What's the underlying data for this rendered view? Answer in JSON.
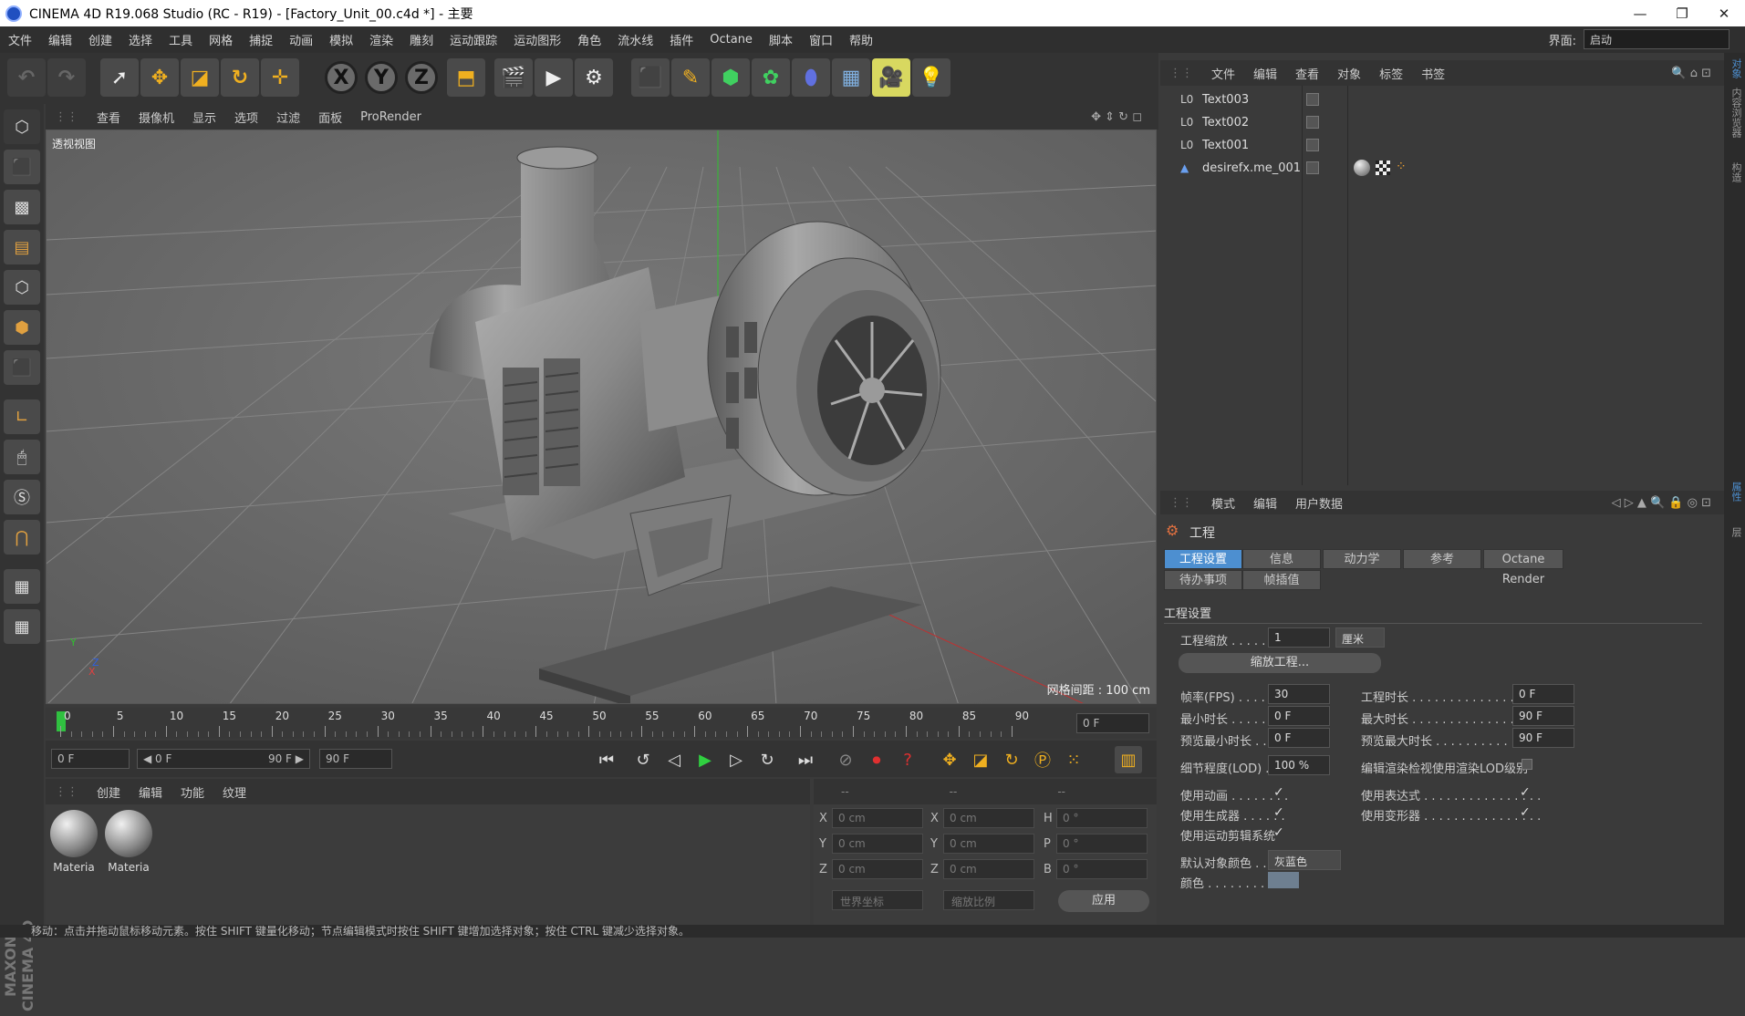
{
  "window": {
    "title": "CINEMA 4D R19.068 Studio (RC - R19) - [Factory_Unit_00.c4d *] - 主要",
    "minimize": "—",
    "restore": "❐",
    "close": "✕"
  },
  "menubar": {
    "items": [
      "文件",
      "编辑",
      "创建",
      "选择",
      "工具",
      "网格",
      "捕捉",
      "动画",
      "模拟",
      "渲染",
      "雕刻",
      "运动跟踪",
      "运动图形",
      "角色",
      "流水线",
      "插件",
      "Octane",
      "脚本",
      "窗口",
      "帮助"
    ],
    "layout_label": "界面:",
    "layout_value": "启动"
  },
  "toolbar": {
    "undo_icon": "undo-icon",
    "redo_icon": "redo-icon",
    "axis_x": "X",
    "axis_y": "Y",
    "axis_z": "Z"
  },
  "viewport": {
    "menu": [
      "查看",
      "摄像机",
      "显示",
      "选项",
      "过滤",
      "面板",
      "ProRender"
    ],
    "label": "透视视图",
    "grid_distance": "网格间距 : 100 cm",
    "axis_x": "X",
    "axis_y": "Y",
    "axis_z": "Z",
    "colors": {
      "background": "#6e6e6e",
      "grid": "#7c7c7c",
      "model": "#8e8e8e"
    }
  },
  "timeline": {
    "ticks": [
      "0",
      "5",
      "10",
      "15",
      "20",
      "25",
      "30",
      "35",
      "40",
      "45",
      "50",
      "55",
      "60",
      "65",
      "70",
      "75",
      "80",
      "85",
      "90"
    ],
    "current_frame": "0 F",
    "start_field": "0 F",
    "range_start": "◀ 0 F",
    "range_end": "90 F ▶",
    "end_field": "90 F"
  },
  "material_manager": {
    "menu": [
      "创建",
      "编辑",
      "功能",
      "纹理"
    ],
    "materials": [
      {
        "label": "Materia"
      },
      {
        "label": "Materia"
      }
    ]
  },
  "coordinates": {
    "head": [
      "--",
      "--",
      "--"
    ],
    "rows": [
      {
        "l1": "X",
        "v1": "0 cm",
        "l2": "X",
        "v2": "0 cm",
        "l3": "H",
        "v3": "0 °"
      },
      {
        "l1": "Y",
        "v1": "0 cm",
        "l2": "Y",
        "v2": "0 cm",
        "l3": "P",
        "v3": "0 °"
      },
      {
        "l1": "Z",
        "v1": "0 cm",
        "l2": "Z",
        "v2": "0 cm",
        "l3": "B",
        "v3": "0 °"
      }
    ],
    "world_coord": "世界坐标",
    "scale_ratio": "缩放比例",
    "apply": "应用"
  },
  "status": "移动：点击并拖动鼠标移动元素。按住 SHIFT 键量化移动；节点编辑模式时按住 SHIFT 键增加选择对象；按住 CTRL 键减少选择对象。",
  "object_manager": {
    "menu": [
      "文件",
      "编辑",
      "查看",
      "对象",
      "标签",
      "书签"
    ],
    "objects": [
      {
        "icon": "L0",
        "name": "Text003"
      },
      {
        "icon": "L0",
        "name": "Text002"
      },
      {
        "icon": "L0",
        "name": "Text001"
      },
      {
        "icon": "▲",
        "name": "desirefx.me_001"
      }
    ]
  },
  "attribute_manager": {
    "menu": [
      "模式",
      "编辑",
      "用户数据"
    ],
    "title": "工程",
    "tabs_row1": [
      "工程设置",
      "信息",
      "动力学",
      "参考",
      "Octane Render"
    ],
    "tabs_row2": [
      "待办事项",
      "帧插值"
    ],
    "section": "工程设置",
    "project_scale_label": "工程缩放 . . . . . . . .",
    "project_scale_value": "1",
    "project_scale_unit": "厘米",
    "scale_project_btn": "缩放工程...",
    "fps_label": "帧率(FPS) . . . . . . .",
    "fps_value": "30",
    "project_time_label": "工程时长 . . . . . . . . . . . . . . . . . .",
    "project_time_value": "0 F",
    "min_time_label": "最小时长 . . . . . . . .",
    "min_time_value": "0 F",
    "max_time_label": "最大时长 . . . . . . . . . . . . . . . . . .",
    "max_time_value": "90 F",
    "preview_min_label": "预览最小时长 . . .",
    "preview_min_value": "0 F",
    "preview_max_label": "预览最大时长 . . . . . . . . . . . . . .",
    "preview_max_value": "90 F",
    "lod_label": "细节程度(LOD) . . .",
    "lod_value": "100 %",
    "render_lod_label": "编辑渲染检视使用渲染LOD级别",
    "use_animation": "使用动画 . . . . . . . .",
    "use_expression": "使用表达式 . . . . . . . . . . . . . . . .",
    "use_generator": "使用生成器 . . . . . .",
    "use_deformer": "使用变形器 . . . . . . . . . . . . . . . .",
    "use_motion_clip": "使用运动剪辑系统",
    "check_mark": "✓",
    "default_color_label": "默认对象颜色 . .",
    "default_color_value": "灰蓝色",
    "color_label": "颜色 . . . . . . . . . .",
    "color_swatch": "#6e7f90"
  },
  "right_strip": [
    "对象",
    "内容浏览器",
    "构造",
    "属性",
    "层"
  ]
}
